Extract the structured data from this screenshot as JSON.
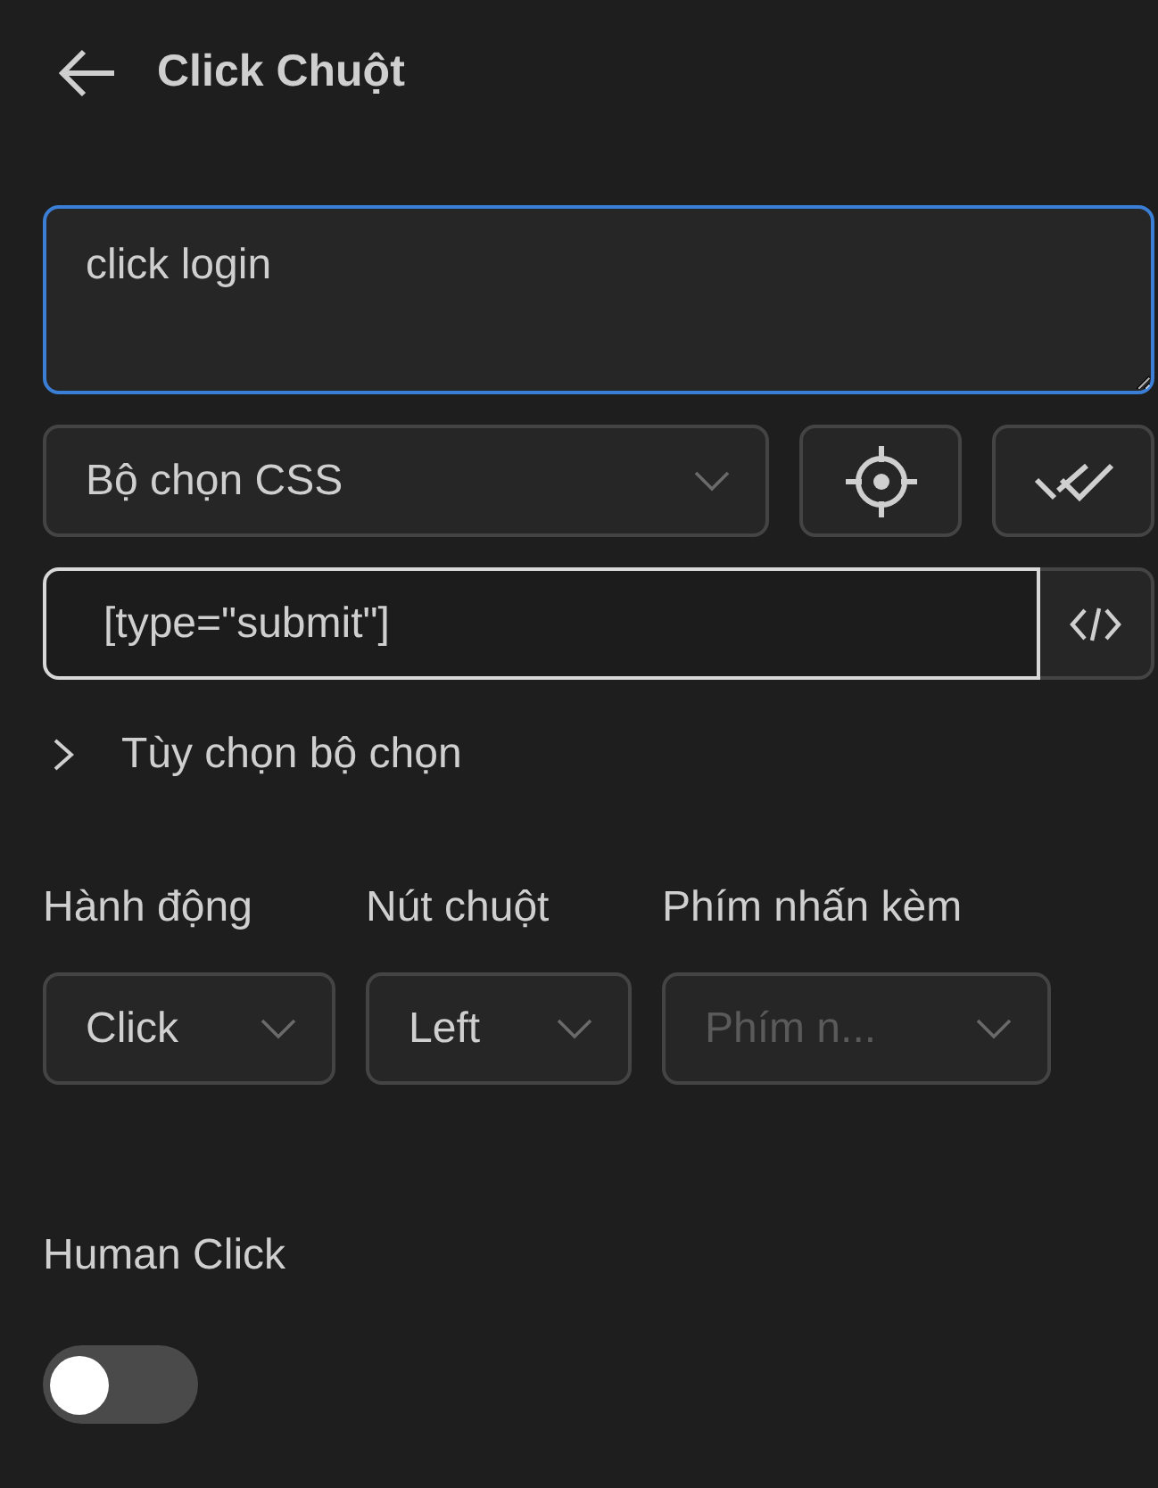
{
  "header": {
    "title": "Click Chuột"
  },
  "description": {
    "value": "click login",
    "focused": true
  },
  "selector_type": {
    "value": "Bộ chọn CSS"
  },
  "selector": {
    "value": "[type=\"submit\"]",
    "focused": true
  },
  "selector_options": {
    "label": "Tùy chọn bộ chọn",
    "expanded": false
  },
  "fields": [
    {
      "label": "Hành động",
      "value": "Click"
    },
    {
      "label": "Nút chuột",
      "value": "Left"
    },
    {
      "label": "Phím nhấn kèm",
      "placeholder": "Phím n..."
    }
  ],
  "human_click": {
    "label": "Human Click",
    "on": false
  }
}
